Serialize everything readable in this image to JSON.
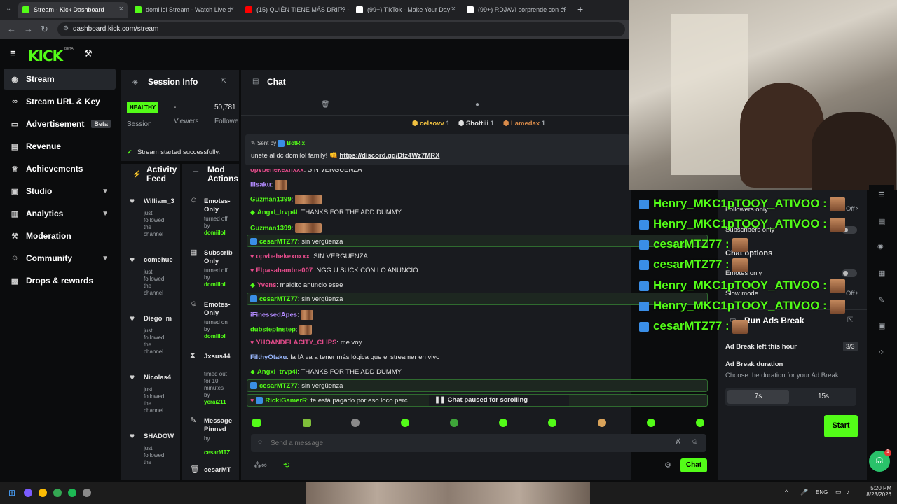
{
  "browser": {
    "tabs": [
      {
        "title": "Stream - Kick Dashboard",
        "color": "#53fc18",
        "active": true
      },
      {
        "title": "domiilol Stream - Watch Live o",
        "color": "#53fc18"
      },
      {
        "title": "(15) QUIÉN TIENE MÁS DRIP? -",
        "color": "#ff0000"
      },
      {
        "title": "(99+) TikTok - Make Your Day",
        "color": "#ffffff"
      },
      {
        "title": "(99+) RDJAVI sorprende con el",
        "color": "#ffffff"
      }
    ],
    "url": "dashboard.kick.com/stream"
  },
  "kick": {
    "logo": "KICK",
    "beta": "BETA"
  },
  "sidebar": {
    "items": [
      {
        "label": "Stream",
        "icon": "broadcast-icon"
      },
      {
        "label": "Stream URL & Key",
        "icon": "link-icon"
      },
      {
        "label": "Advertisement",
        "icon": "ad-icon",
        "badge": "Beta"
      },
      {
        "label": "Revenue",
        "icon": "revenue-icon"
      },
      {
        "label": "Achievements",
        "icon": "trophy-icon"
      },
      {
        "label": "Studio",
        "icon": "studio-icon"
      },
      {
        "label": "Analytics",
        "icon": "analytics-icon"
      },
      {
        "label": "Moderation",
        "icon": "hammer-icon"
      },
      {
        "label": "Community",
        "icon": "community-icon"
      },
      {
        "label": "Drops & rewards",
        "icon": "gift-icon"
      }
    ]
  },
  "session": {
    "title": "Session Info",
    "health": "HEALTHY",
    "health_label": "Session",
    "viewers_value": "-",
    "viewers_label": "Viewers",
    "followers_value": "50,781",
    "followers_label": "Followe",
    "status": "Stream started successfully."
  },
  "activity": {
    "title": "Activity Feed",
    "entries": [
      {
        "name": "William_3",
        "text": "just followed the channel"
      },
      {
        "name": "comehue",
        "text": "just followed the channel"
      },
      {
        "name": "Diego_m",
        "text": "just followed the channel"
      },
      {
        "name": "Nicolas4",
        "text": "just followed the channel"
      },
      {
        "name": "SHADOW",
        "text": "just followed the"
      }
    ]
  },
  "mod": {
    "title": "Mod Actions",
    "entries": [
      {
        "name": "Emotes-Only",
        "line1": "turned off",
        "line2": "by",
        "user": "domiilol"
      },
      {
        "name": "Subscrib Only",
        "line1": "turned off",
        "line2": "by",
        "user": "domiilol"
      },
      {
        "name": "Emotes-Only",
        "line1": "turned on",
        "line2": "by",
        "user": "domiilol"
      },
      {
        "name": "Jxsus44",
        "line1": "timed out for 10 minutes",
        "line2": "by",
        "user": "yerai211"
      },
      {
        "name": "Message Pinned",
        "line1": "by",
        "line2": "",
        "user": "cesarMTZ"
      },
      {
        "name": "cesarMT",
        "line1": "",
        "line2": "",
        "user": ""
      }
    ]
  },
  "chat": {
    "title": "Chat",
    "gifters": [
      {
        "name": "celsovv",
        "count": "1"
      },
      {
        "name": "Shottiii",
        "count": "1"
      },
      {
        "name": "Lamedax",
        "count": "1"
      }
    ],
    "pinned": {
      "sent_by": "Sent by",
      "author": "BotRix",
      "text": "unete al dc domilol family! 👊",
      "link": "https://discord.gg/Dtz4Wz7MRX"
    },
    "messages": [
      {
        "user": "opvbehekexnxxx",
        "color": "#e64c8c",
        "text": ": SIN VERGUENZA"
      },
      {
        "user": "lilsaku",
        "color": "#b38aff",
        "text": ":"
      },
      {
        "user": "Guzman1399",
        "color": "#53fc18",
        "text": ":"
      },
      {
        "user": "Angxl_trvp4l",
        "color": "#53fc18",
        "text": ": THANKS FOR THE ADD DUMMY"
      },
      {
        "user": "Guzman1399",
        "color": "#53fc18",
        "text": ":"
      },
      {
        "user": "cesarMTZ77",
        "color": "#53fc18",
        "text": ": sin vergüenza"
      },
      {
        "user": "opvbehekexnxxx",
        "color": "#e64c8c",
        "text": ": SIN VERGUENZA"
      },
      {
        "user": "Elpasahambre007",
        "color": "#e64c8c",
        "text": ": NGG U SUCK CON LO ANUNCIO"
      },
      {
        "user": "Yvens",
        "color": "#e64c8c",
        "text": ": maldito anuncio esee"
      },
      {
        "user": "cesarMTZ77",
        "color": "#53fc18",
        "text": ": sin vergüenza"
      },
      {
        "user": "iFinessedApes",
        "color": "#b38aff",
        "text": ":"
      },
      {
        "user": "dubstepinstep",
        "color": "#53fc18",
        "text": ":"
      },
      {
        "user": "YHOANDELACITY_CLIPS",
        "color": "#e64c8c",
        "text": ": me voy"
      },
      {
        "user": "FilthyOtaku",
        "color": "#9ab8ff",
        "text": ": la IA va a tener más lógica que el streamer en vivo"
      },
      {
        "user": "Angxl_trvp4l",
        "color": "#53fc18",
        "text": ": THANKS FOR THE ADD DUMMY"
      },
      {
        "user": "cesarMTZ77",
        "color": "#53fc18",
        "text": ": sin vergüenza"
      },
      {
        "user": "RickiGamerR",
        "color": "#53fc18",
        "text": ": te está pagado por eso loco perc"
      }
    ],
    "paused": "Chat paused for scrolling",
    "input_placeholder": "Send a message",
    "send_label": "Chat"
  },
  "overlay": {
    "lines": [
      {
        "user": "Henry_MKC1pTOOY_ATIVOO",
        "suffix": ":"
      },
      {
        "user": "Henry_MKC1pTOOY_ATIVOO",
        "suffix": ":"
      },
      {
        "user": "cesarMTZ77",
        "suffix": ":"
      },
      {
        "user": "cesarMTZ77",
        "suffix": ":"
      },
      {
        "user": "Henry_MKC1pTOOY_ATIVOO",
        "suffix": ":"
      },
      {
        "user": "Henry_MKC1pTOOY_ATIVOO",
        "suffix": ":"
      },
      {
        "user": "cesarMTZ77",
        "suffix": ":"
      }
    ]
  },
  "chat_options": {
    "followers_only": "Followers only",
    "followers_value": "Off",
    "subscribers_only": "Subscribers only",
    "title": "Chat options",
    "emotes_only": "Emotes only",
    "slow_mode": "Slow mode",
    "slow_value": "Off"
  },
  "ads": {
    "title": "Run Ads Break",
    "left_label": "Ad Break left this hour",
    "left_value": "3/3",
    "duration_title": "Ad Break duration",
    "duration_desc": "Choose the duration for your Ad Break.",
    "options": [
      "7s",
      "15s"
    ],
    "start": "Start"
  },
  "help": {
    "badge": "1"
  },
  "taskbar": {
    "lang": "ENG",
    "time": "5:20 PM",
    "date": "8/23/2026"
  }
}
